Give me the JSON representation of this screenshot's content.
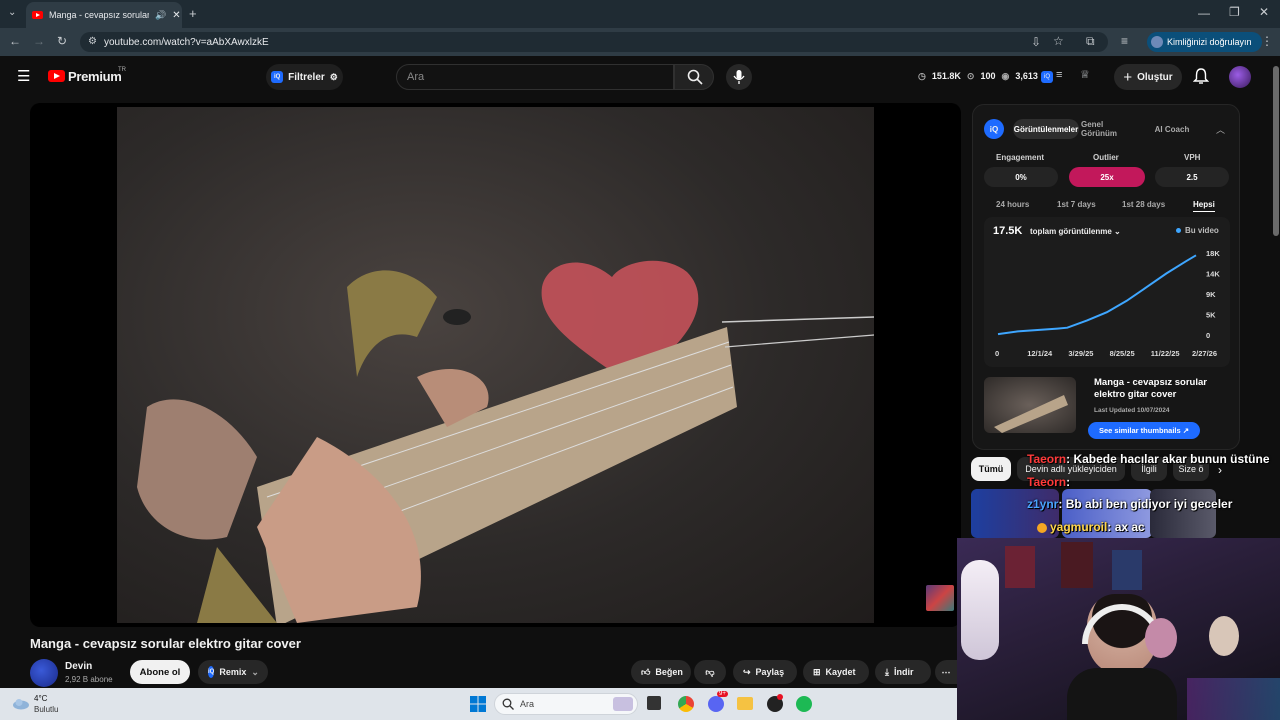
{
  "browser": {
    "tab_title": "Manga - cevapsız sorular el",
    "url": "youtube.com/watch?v=aAbXAwxlzkE",
    "identity_chip": "Kimliğinizi doğrulayın"
  },
  "yt_header": {
    "logo_text": "Premium",
    "logo_super": "TR",
    "filters_label": "Filtreler",
    "search_placeholder": "Ara",
    "stats": [
      "151.8K",
      "100",
      "3,613"
    ],
    "create_label": "Oluştur"
  },
  "iq_panel": {
    "tabs": [
      "Görüntülenmeler",
      "Genel Görünüm",
      "AI Coach"
    ],
    "metrics": [
      {
        "label": "Engagement",
        "value": "0%"
      },
      {
        "label": "Outlier",
        "value": "25x"
      },
      {
        "label": "VPH",
        "value": "2.5"
      }
    ],
    "ranges": [
      "24 hours",
      "1st 7 days",
      "1st 28 days",
      "Hepsi"
    ],
    "total_views": "17.5K",
    "views_dropdown": "toplam görüntülenme",
    "legend": "Bu video",
    "video_title": "Manga - cevapsız sorular elektro gitar cover",
    "last_updated": "Last Updated 10/07/2024",
    "similar_button": "See similar thumbnails ↗"
  },
  "chart_data": {
    "type": "line",
    "series": [
      {
        "name": "Bu video",
        "values": [
          [
            0,
            0.2
          ],
          [
            0.1,
            0.8
          ],
          [
            0.2,
            1.1
          ],
          [
            0.3,
            1.4
          ],
          [
            0.35,
            1.6
          ],
          [
            0.45,
            3.2
          ],
          [
            0.55,
            5.0
          ],
          [
            0.65,
            7.5
          ],
          [
            0.75,
            10.5
          ],
          [
            0.85,
            13.5
          ],
          [
            0.95,
            16.2
          ],
          [
            1.0,
            17.5
          ]
        ]
      }
    ],
    "x_tick_labels": [
      "0",
      "12/1/24",
      "3/29/25",
      "8/25/25",
      "11/22/25",
      "2/27/26"
    ],
    "y_tick_labels": [
      "18K",
      "14K",
      "9K",
      "5K",
      "0"
    ],
    "ylim": [
      0,
      18
    ],
    "grid": false,
    "legend_position": "top-right"
  },
  "filter_chips": [
    "Tümü",
    "Devin adlı yükleyiciden",
    "İlgili",
    "Size ö"
  ],
  "chat_overlay": [
    {
      "user": "Taeorn",
      "text": ": Kabede hacılar akar bunun üstüne",
      "color": "#ff3a3a"
    },
    {
      "user": "Taeorn",
      "text": ":",
      "color": "#ff3a3a"
    },
    {
      "user": "z1ynr",
      "text": ": Bb abi ben gidiyor iyi geceler",
      "color": "#4aa3ff"
    },
    {
      "user": "yagmuroil",
      "text": ": ax ac",
      "color": "#ffd54a"
    }
  ],
  "video": {
    "title": "Manga - cevapsız sorular elektro gitar cover",
    "channel": "Devin",
    "subscribers": "2,92 B abone",
    "subscribe_label": "Abone ol",
    "remix_label": "Remix",
    "like_label": "Beğen",
    "share_label": "Paylaş",
    "save_label": "Kaydet",
    "download_label": "İndir"
  },
  "taskbar": {
    "weather_temp": "4°C",
    "weather_desc": "Bulutlu",
    "search_placeholder": "Ara",
    "discord_badge": "9+"
  },
  "colors": {
    "accent_red": "#ff0000",
    "outlier_pill": "#c2185b",
    "iq_blue": "#1e6bff",
    "chart_line": "#3ea6ff"
  }
}
